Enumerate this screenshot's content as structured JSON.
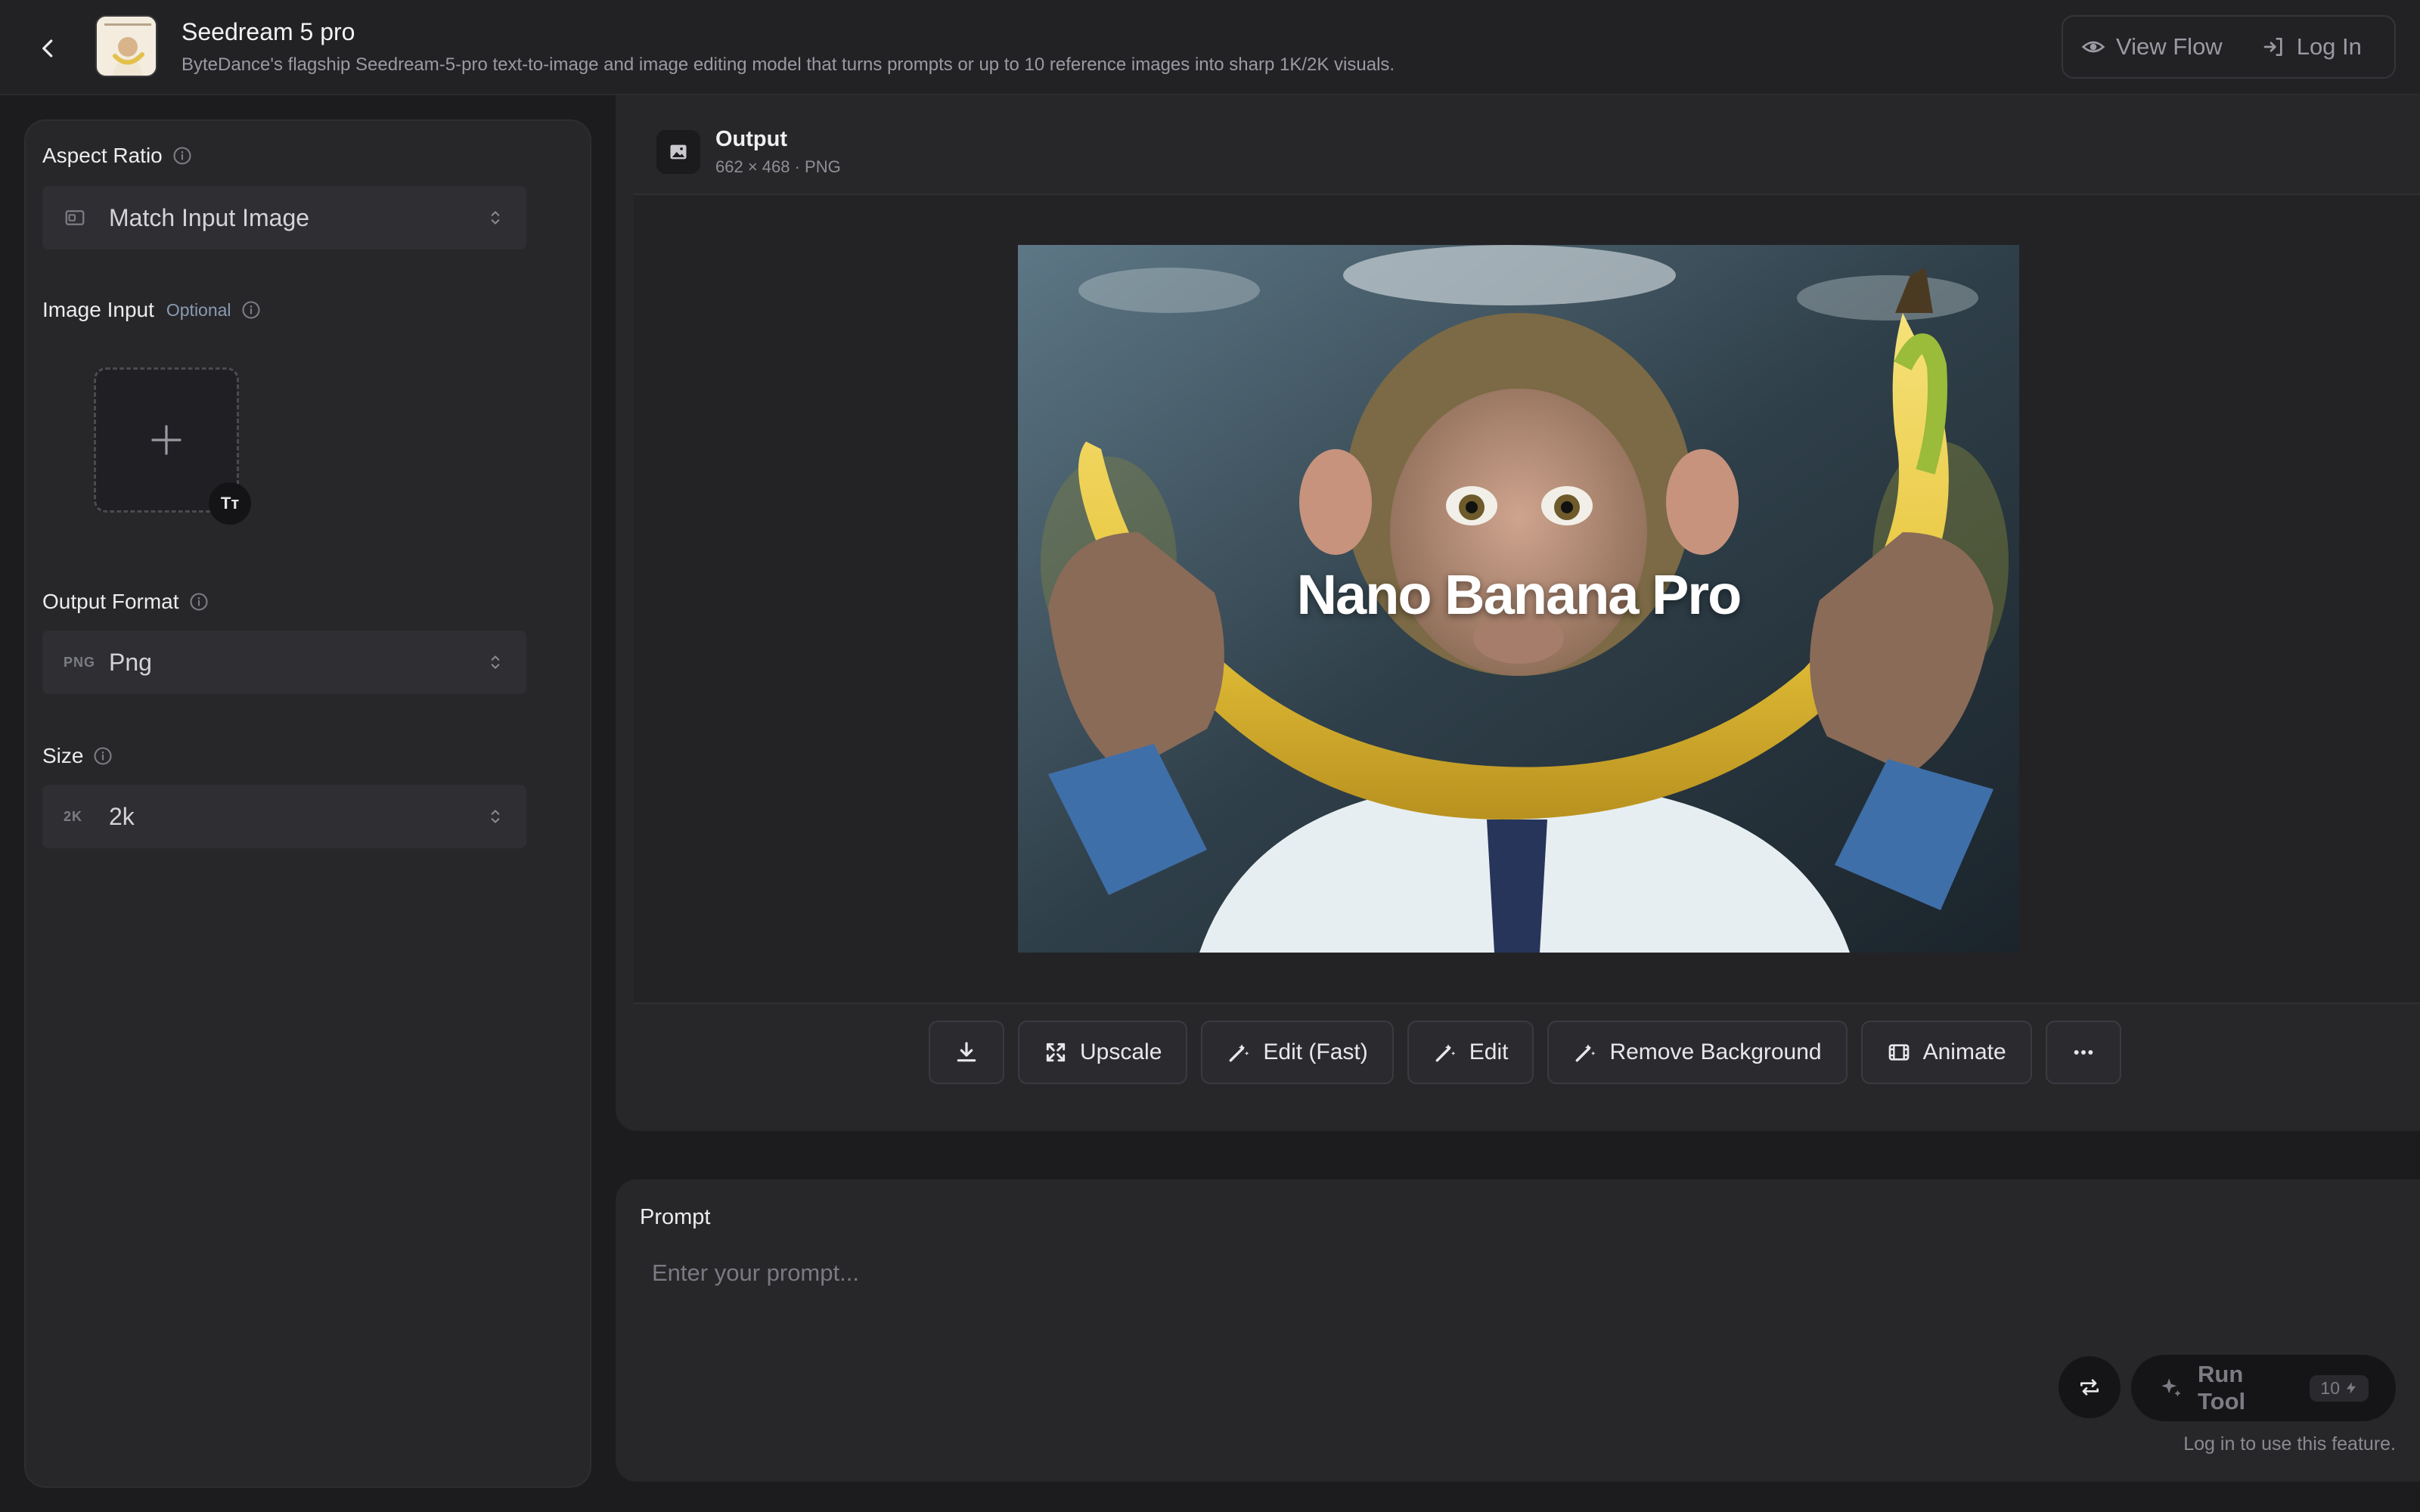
{
  "header": {
    "title": "Seedream 5 pro",
    "subtitle": "ByteDance's flagship Seedream-5-pro text-to-image and image editing model that turns prompts or up to 10 reference images into sharp 1K/2K visuals.",
    "view_flow": "View Flow",
    "log_in": "Log In"
  },
  "sidebar": {
    "aspect_ratio": {
      "label": "Aspect Ratio",
      "value": "Match Input Image"
    },
    "image_input": {
      "label": "Image Input",
      "optional": "Optional",
      "badge": "Tт"
    },
    "output_format": {
      "label": "Output Format",
      "prefix": "PNG",
      "value": "Png"
    },
    "size": {
      "label": "Size",
      "prefix": "2K",
      "value": "2k"
    }
  },
  "output": {
    "title": "Output",
    "meta": "662 × 468 · PNG",
    "image_caption": "Nano Banana Pro"
  },
  "actions": {
    "upscale": "Upscale",
    "edit_fast": "Edit (Fast)",
    "edit": "Edit",
    "remove_background": "Remove Background",
    "animate": "Animate"
  },
  "prompt": {
    "label": "Prompt",
    "placeholder": "Enter your prompt...",
    "run_tool": "Run Tool",
    "credits": "10",
    "login_note": "Log in to use this feature."
  },
  "colors": {
    "background": "#1c1c1f",
    "panel": "#27272a",
    "header": "#222225",
    "muted_text": "#9a9aa3",
    "optional_accent": "#8a9bb3"
  },
  "icons": [
    "back-arrow-icon",
    "eye-icon",
    "login-icon",
    "info-icon",
    "aspect-ratio-icon",
    "chevron-updown-icon",
    "plus-icon",
    "image-icon",
    "download-icon",
    "expand-icon",
    "magic-wand-icon",
    "film-icon",
    "more-icon",
    "swap-icon",
    "sparkle-icon",
    "bolt-icon"
  ]
}
